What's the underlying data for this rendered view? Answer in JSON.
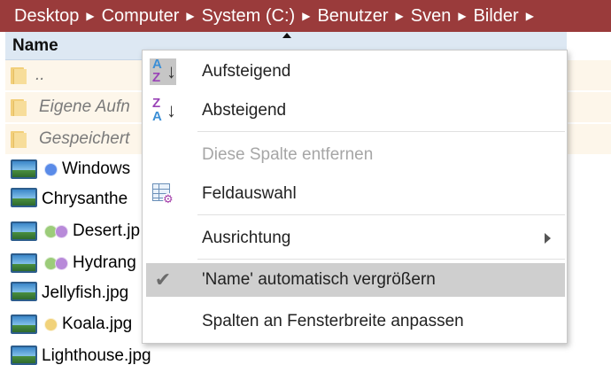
{
  "breadcrumb": {
    "items": [
      "Desktop",
      "Computer",
      "System (C:)",
      "Benutzer",
      "Sven",
      "Bilder"
    ],
    "separator_icon": "chevron-right-icon",
    "background": "#9a3b3b"
  },
  "column_header": {
    "label": "Name",
    "sort_indicator_icon": "sort-ascending-icon"
  },
  "files": [
    {
      "label": "..",
      "type": "folder",
      "style": "italic"
    },
    {
      "label": "Eigene Aufn",
      "type": "folder",
      "style": "italic"
    },
    {
      "label": "Gespeichert",
      "type": "folder",
      "style": "italic"
    },
    {
      "label": "Windows",
      "type": "image",
      "tags": [
        "#5a8be8"
      ]
    },
    {
      "label": "Chrysanthe",
      "type": "image",
      "tags": []
    },
    {
      "label": "Desert.jp",
      "type": "image",
      "tags": [
        "#9ccc7a",
        "#b88ad9"
      ]
    },
    {
      "label": "Hydrang",
      "type": "image",
      "tags": [
        "#9ccc7a",
        "#b88ad9"
      ]
    },
    {
      "label": "Jellyfish.jpg",
      "type": "image",
      "tags": []
    },
    {
      "label": "Koala.jpg",
      "type": "image",
      "tags": [
        "#f1d27a"
      ]
    },
    {
      "label": "Lighthouse.jpg",
      "type": "image",
      "tags": []
    }
  ],
  "context_menu": {
    "items": [
      {
        "label": "Aufsteigend",
        "icon": "sort-az-ascending-icon",
        "state": "checked"
      },
      {
        "label": "Absteigend",
        "icon": "sort-za-descending-icon"
      },
      {
        "label": "Diese Spalte entfernen",
        "state": "disabled"
      },
      {
        "label": "Feldauswahl",
        "icon": "field-chooser-icon"
      },
      {
        "label": "Ausrichtung",
        "icon": "submenu-arrow-icon"
      },
      {
        "label": "'Name' automatisch vergrößern",
        "icon": "checkmark-icon",
        "state": "highlighted"
      },
      {
        "label": "Spalten an Fensterbreite anpassen"
      }
    ]
  }
}
